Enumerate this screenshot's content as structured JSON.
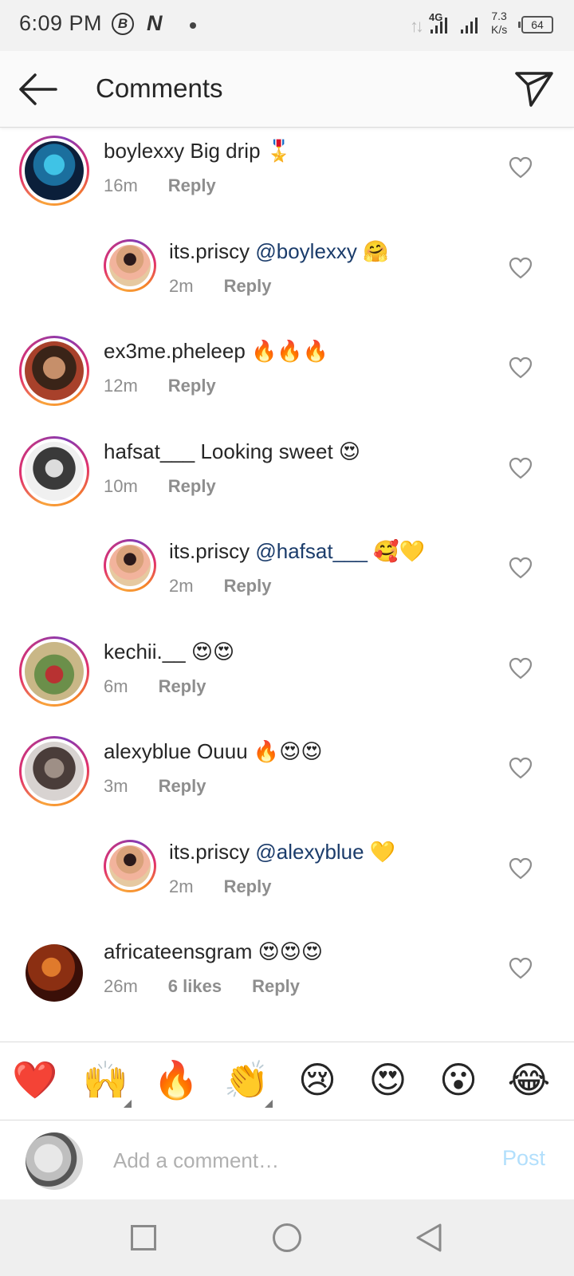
{
  "status_bar": {
    "time": "6:09 PM",
    "b_icon_letter": "B",
    "n_icon_letter": "N",
    "network": "4G",
    "speed_value": "7.3",
    "speed_unit": "K/s",
    "battery": "64"
  },
  "header": {
    "title": "Comments",
    "back_icon": "arrow-left-icon",
    "send_icon": "paper-plane-icon"
  },
  "comments": [
    {
      "user": "boylexxy",
      "text": " Big drip ",
      "mention": "",
      "emoji": "🎖️",
      "time": "16m",
      "likes": "",
      "reply": "Reply",
      "is_reply": false
    },
    {
      "user": "its.priscy",
      "text": " ",
      "mention": "@boylexxy",
      "emoji": " 🤗",
      "time": "2m",
      "likes": "",
      "reply": "Reply",
      "is_reply": true
    },
    {
      "user": "ex3me.pheleep",
      "text": " ",
      "mention": "",
      "emoji": "🔥🔥🔥",
      "time": "12m",
      "likes": "",
      "reply": "Reply",
      "is_reply": false
    },
    {
      "user": "hafsat___",
      "text": " Looking sweet ",
      "mention": "",
      "emoji": "😍",
      "time": "10m",
      "likes": "",
      "reply": "Reply",
      "is_reply": false
    },
    {
      "user": "its.priscy",
      "text": " ",
      "mention": "@hafsat___",
      "emoji": " 🥰💛",
      "time": "2m",
      "likes": "",
      "reply": "Reply",
      "is_reply": true
    },
    {
      "user": "kechii.__",
      "text": " ",
      "mention": "",
      "emoji": "😍😍",
      "time": "6m",
      "likes": "",
      "reply": "Reply",
      "is_reply": false
    },
    {
      "user": "alexyblue",
      "text": " Ouuu ",
      "mention": "",
      "emoji": "🔥😍😍",
      "time": "3m",
      "likes": "",
      "reply": "Reply",
      "is_reply": false
    },
    {
      "user": "its.priscy",
      "text": " ",
      "mention": "@alexyblue",
      "emoji": " 💛",
      "time": "2m",
      "likes": "",
      "reply": "Reply",
      "is_reply": true
    },
    {
      "user": "africateensgram",
      "text": " ",
      "mention": "",
      "emoji": "😍😍😍",
      "time": "26m",
      "likes": "6 likes",
      "reply": "Reply",
      "is_reply": false
    }
  ],
  "emoji_bar": [
    "❤️",
    "🙌",
    "🔥",
    "👏",
    "😢",
    "😍",
    "😮",
    "😂"
  ],
  "composer": {
    "placeholder": "Add a comment…",
    "post_label": "Post"
  },
  "colors": {
    "mention": "#1b3c6b",
    "meta": "#8e8e8e",
    "post_disabled": "#b2dffc"
  }
}
